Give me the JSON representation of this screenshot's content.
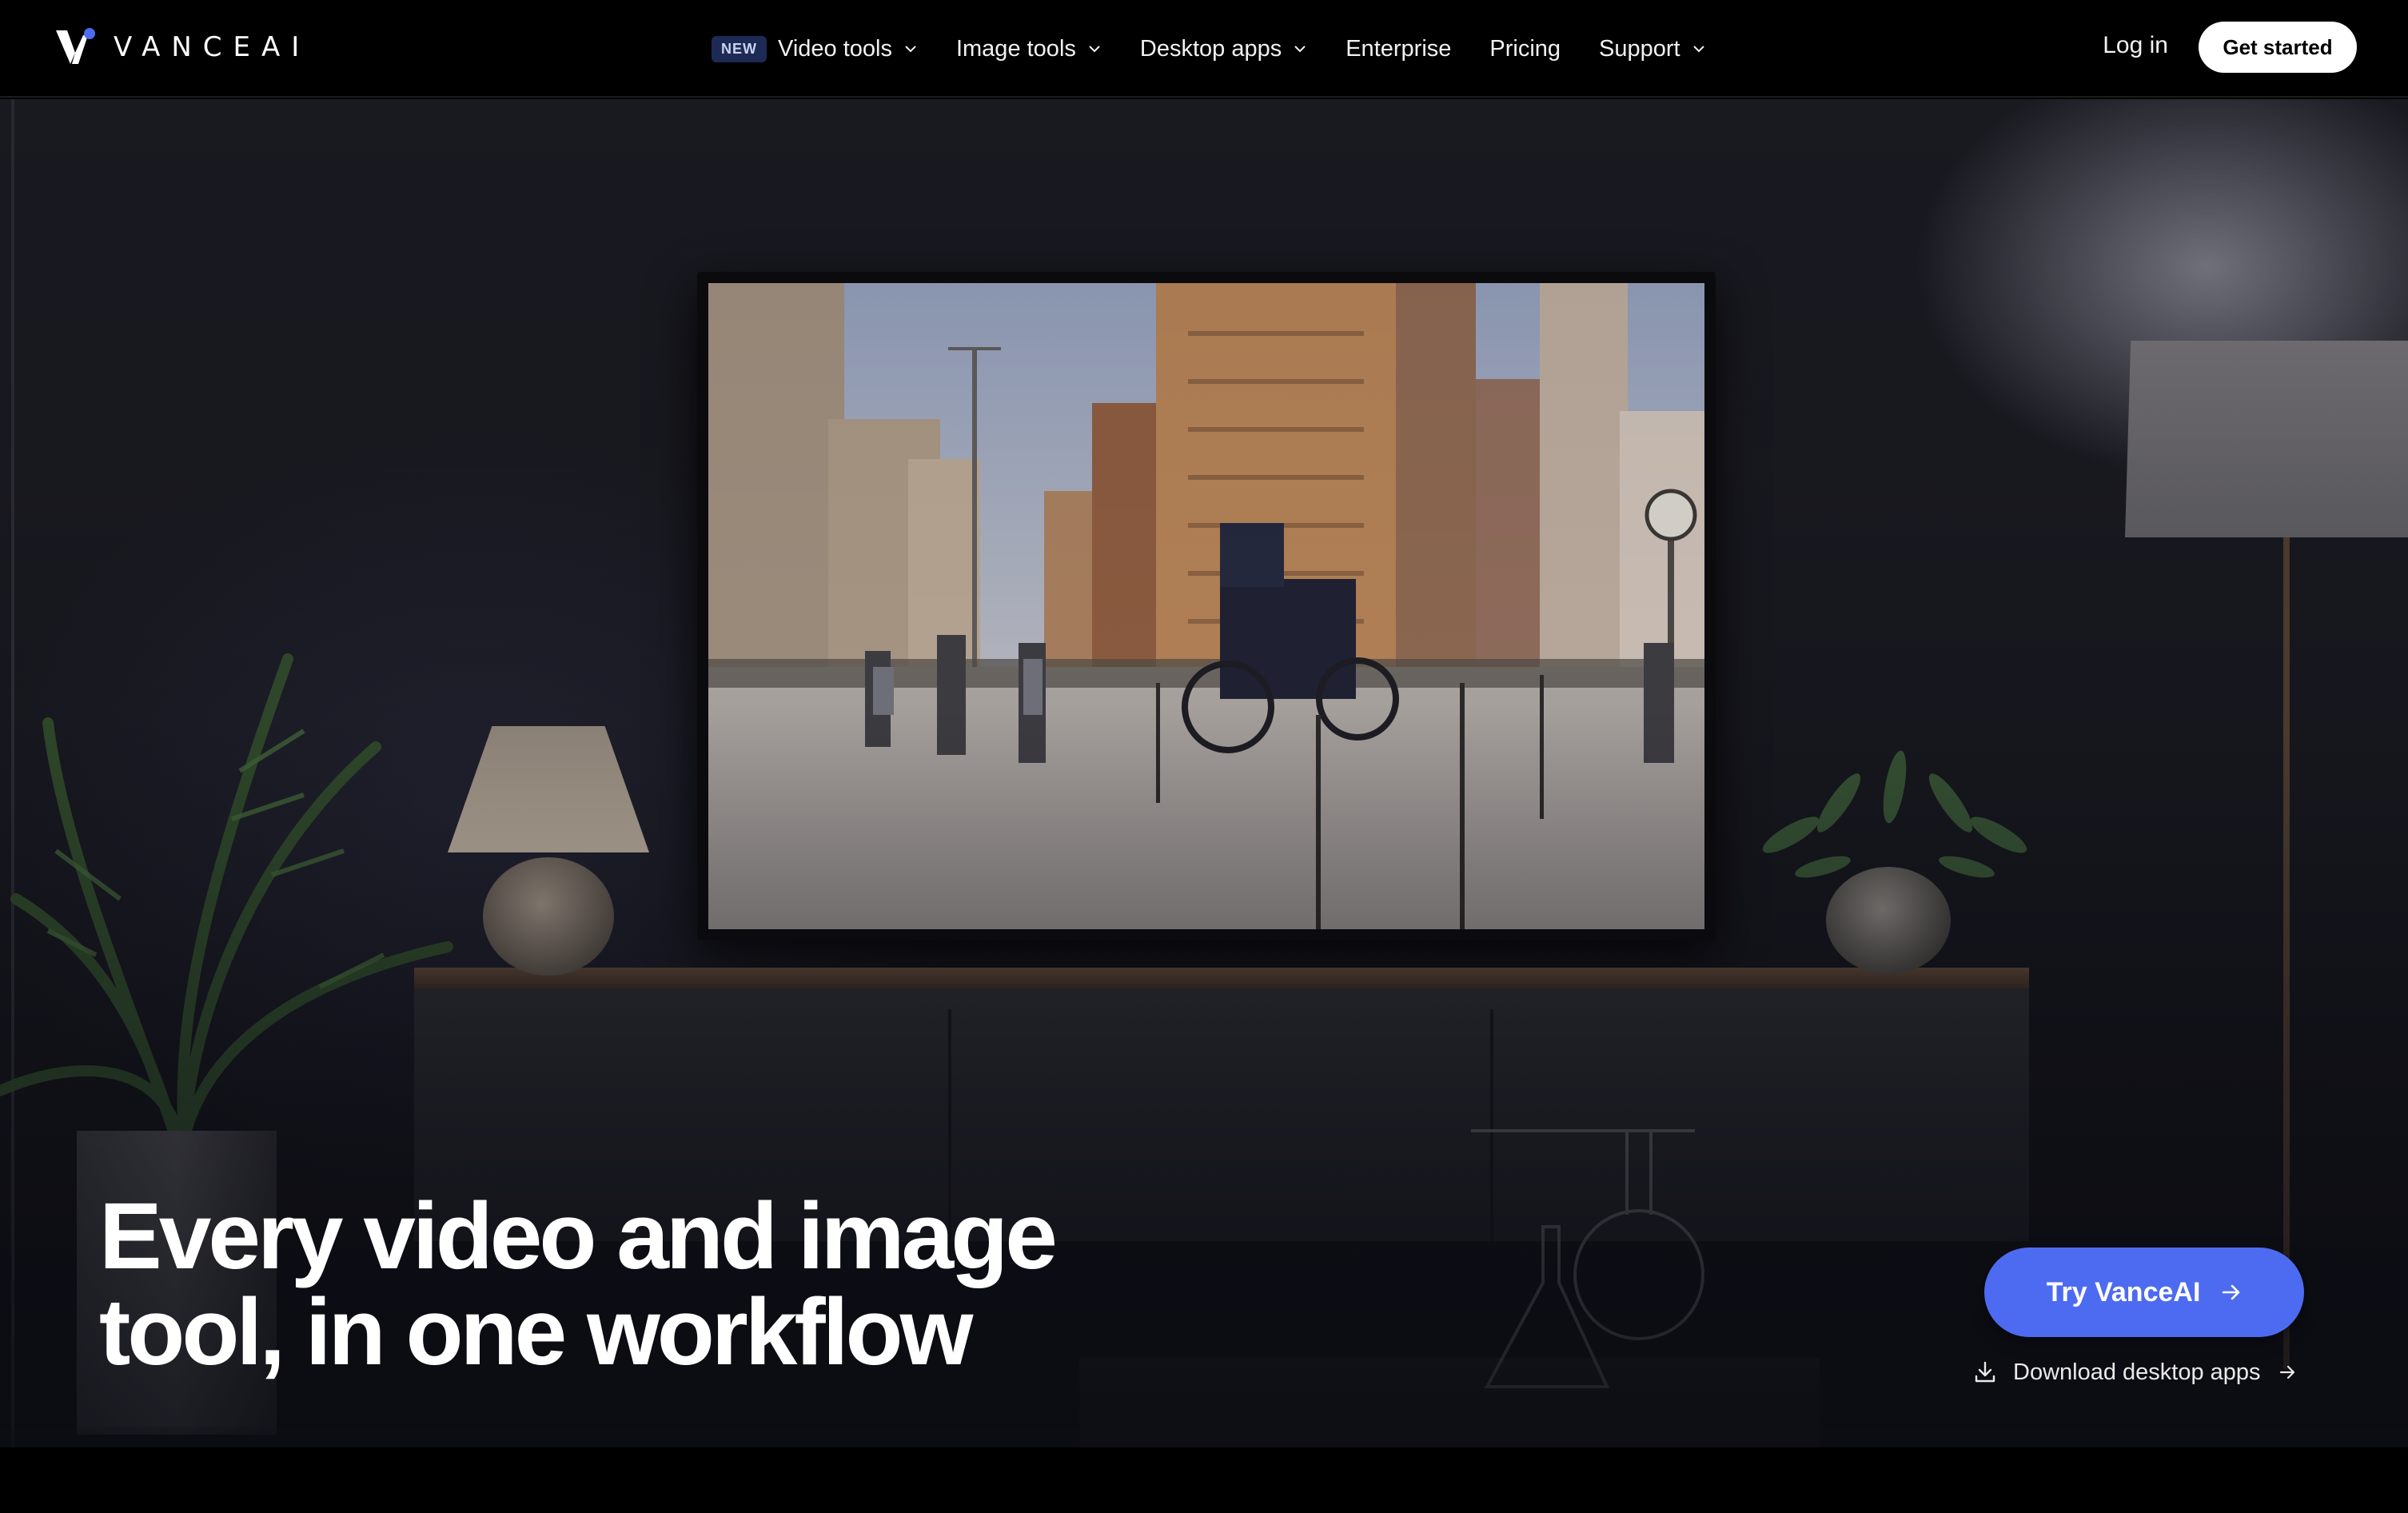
{
  "brand": {
    "name": "VANCEAI",
    "accent": "#4d6bf0"
  },
  "nav": {
    "items": [
      {
        "badge": "NEW",
        "label": "Video tools",
        "has_dropdown": true
      },
      {
        "label": "Image tools",
        "has_dropdown": true
      },
      {
        "label": "Desktop apps",
        "has_dropdown": true
      },
      {
        "label": "Enterprise",
        "has_dropdown": false
      },
      {
        "label": "Pricing",
        "has_dropdown": false
      },
      {
        "label": "Support",
        "has_dropdown": true
      }
    ],
    "login": "Log in",
    "cta": "Get started"
  },
  "hero": {
    "headline_line1": "Every video and image",
    "headline_line2": "tool, in one workflow",
    "primary_cta": "Try VanceAI",
    "secondary_cta": "Download desktop apps"
  }
}
